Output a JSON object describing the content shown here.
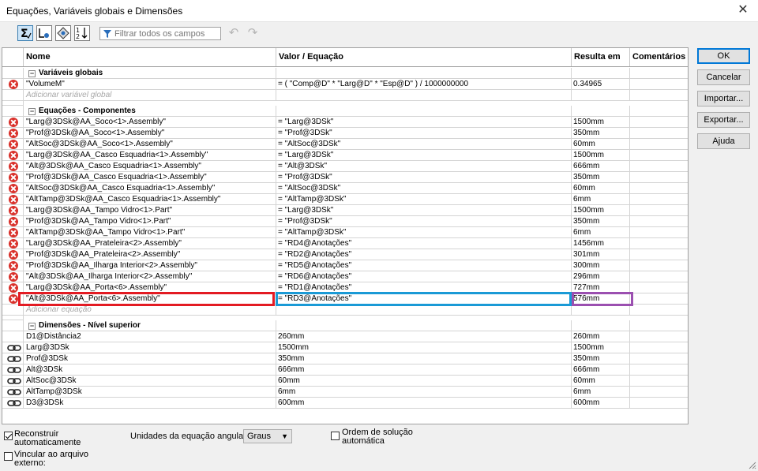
{
  "window": {
    "title": "Equações, Variáveis globais e Dimensões",
    "close_glyph": "✕"
  },
  "toolbar": {
    "filter_placeholder": "Filtrar todos os campos",
    "icons": [
      "equation-view-icon",
      "sketch-equation-view-icon",
      "dimension-view-icon",
      "ordered-view-icon",
      "filter-icon",
      "undo-icon",
      "redo-icon"
    ]
  },
  "columns": {
    "name": "Nome",
    "value": "Valor / Equação",
    "result": "Resulta em",
    "comments": "Comentários"
  },
  "sections": {
    "globals": {
      "title": "Variáveis globais",
      "rows": [
        {
          "name": "\"VolumeM\"",
          "value": "= ( \"Comp@D\" * \"Larg@D\" * \"Esp@D\" ) / 1000000000",
          "result": "0.34965",
          "status": "error"
        }
      ],
      "add_label": "Adicionar variável global"
    },
    "components": {
      "title": "Equações - Componentes",
      "rows": [
        {
          "name": "\"Larg@3DSk@AA_Soco<1>.Assembly\"",
          "value": "= \"Larg@3DSk\"",
          "result": "1500mm",
          "status": "error"
        },
        {
          "name": "\"Prof@3DSk@AA_Soco<1>.Assembly\"",
          "value": "= \"Prof@3DSk\"",
          "result": "350mm",
          "status": "error"
        },
        {
          "name": "\"AltSoc@3DSk@AA_Soco<1>.Assembly\"",
          "value": "= \"AltSoc@3DSk\"",
          "result": "60mm",
          "status": "error"
        },
        {
          "name": "\"Larg@3DSk@AA_Casco Esquadria<1>.Assembly\"",
          "value": "= \"Larg@3DSk\"",
          "result": "1500mm",
          "status": "error"
        },
        {
          "name": "\"Alt@3DSk@AA_Casco Esquadria<1>.Assembly\"",
          "value": "= \"Alt@3DSk\"",
          "result": "666mm",
          "status": "error"
        },
        {
          "name": "\"Prof@3DSk@AA_Casco Esquadria<1>.Assembly\"",
          "value": "= \"Prof@3DSk\"",
          "result": "350mm",
          "status": "error"
        },
        {
          "name": "\"AltSoc@3DSk@AA_Casco Esquadria<1>.Assembly\"",
          "value": "= \"AltSoc@3DSk\"",
          "result": "60mm",
          "status": "error"
        },
        {
          "name": "\"AltTamp@3DSk@AA_Casco Esquadria<1>.Assembly\"",
          "value": "= \"AltTamp@3DSk\"",
          "result": "6mm",
          "status": "error"
        },
        {
          "name": "\"Larg@3DSk@AA_Tampo Vidro<1>.Part\"",
          "value": "= \"Larg@3DSk\"",
          "result": "1500mm",
          "status": "error"
        },
        {
          "name": "\"Prof@3DSk@AA_Tampo Vidro<1>.Part\"",
          "value": "= \"Prof@3DSk\"",
          "result": "350mm",
          "status": "error"
        },
        {
          "name": "\"AltTamp@3DSk@AA_Tampo Vidro<1>.Part\"",
          "value": "= \"AltTamp@3DSk\"",
          "result": "6mm",
          "status": "error"
        },
        {
          "name": "\"Larg@3DSk@AA_Prateleira<2>.Assembly\"",
          "value": "= \"RD4@Anotações\"",
          "result": "1456mm",
          "status": "error"
        },
        {
          "name": "\"Prof@3DSk@AA_Prateleira<2>.Assembly\"",
          "value": "= \"RD2@Anotações\"",
          "result": "301mm",
          "status": "error"
        },
        {
          "name": "\"Prof@3DSk@AA_Ilharga Interior<2>.Assembly\"",
          "value": "= \"RD5@Anotações\"",
          "result": "300mm",
          "status": "error"
        },
        {
          "name": "\"Alt@3DSk@AA_Ilharga Interior<2>.Assembly\"",
          "value": "= \"RD6@Anotações\"",
          "result": "296mm",
          "status": "error"
        },
        {
          "name": "\"Larg@3DSk@AA_Porta<6>.Assembly\"",
          "value": "= \"RD1@Anotações\"",
          "result": "727mm",
          "status": "error"
        },
        {
          "name": "\"Alt@3DSk@AA_Porta<6>.Assembly\"",
          "value": "= \"RD3@Anotações\"",
          "result": "576mm",
          "status": "error"
        }
      ],
      "add_label": "Adicionar equação"
    },
    "dimensions": {
      "title": "Dimensões - Nível superior",
      "rows": [
        {
          "name": "D1@Distância2",
          "value": "260mm",
          "result": "260mm",
          "icon": "none"
        },
        {
          "name": "Larg@3DSk",
          "value": "1500mm",
          "result": "1500mm",
          "icon": "link-icon"
        },
        {
          "name": "Prof@3DSk",
          "value": "350mm",
          "result": "350mm",
          "icon": "link-icon"
        },
        {
          "name": "Alt@3DSk",
          "value": "666mm",
          "result": "666mm",
          "icon": "link-icon"
        },
        {
          "name": "AltSoc@3DSk",
          "value": "60mm",
          "result": "60mm",
          "icon": "link-icon"
        },
        {
          "name": "AltTamp@3DSk",
          "value": "6mm",
          "result": "6mm",
          "icon": "link-icon"
        },
        {
          "name": "D3@3DSk",
          "value": "600mm",
          "result": "600mm",
          "icon": "link-icon"
        }
      ]
    }
  },
  "highlight_colors": {
    "name": "#e31b23",
    "value": "#1a9ad6",
    "result": "#9b4fb0"
  },
  "buttons": {
    "ok": "OK",
    "cancel": "Cancelar",
    "import": "Importar...",
    "export": "Exportar...",
    "help": "Ajuda"
  },
  "footer": {
    "rebuild_label": "Reconstruir automaticamente",
    "rebuild_checked": true,
    "link_label": "Vincular ao arquivo externo:",
    "link_checked": false,
    "angle_label": "Unidades da equação angular:",
    "angle_value": "Graus",
    "order_label": "Ordem de solução automática",
    "order_checked": false
  }
}
